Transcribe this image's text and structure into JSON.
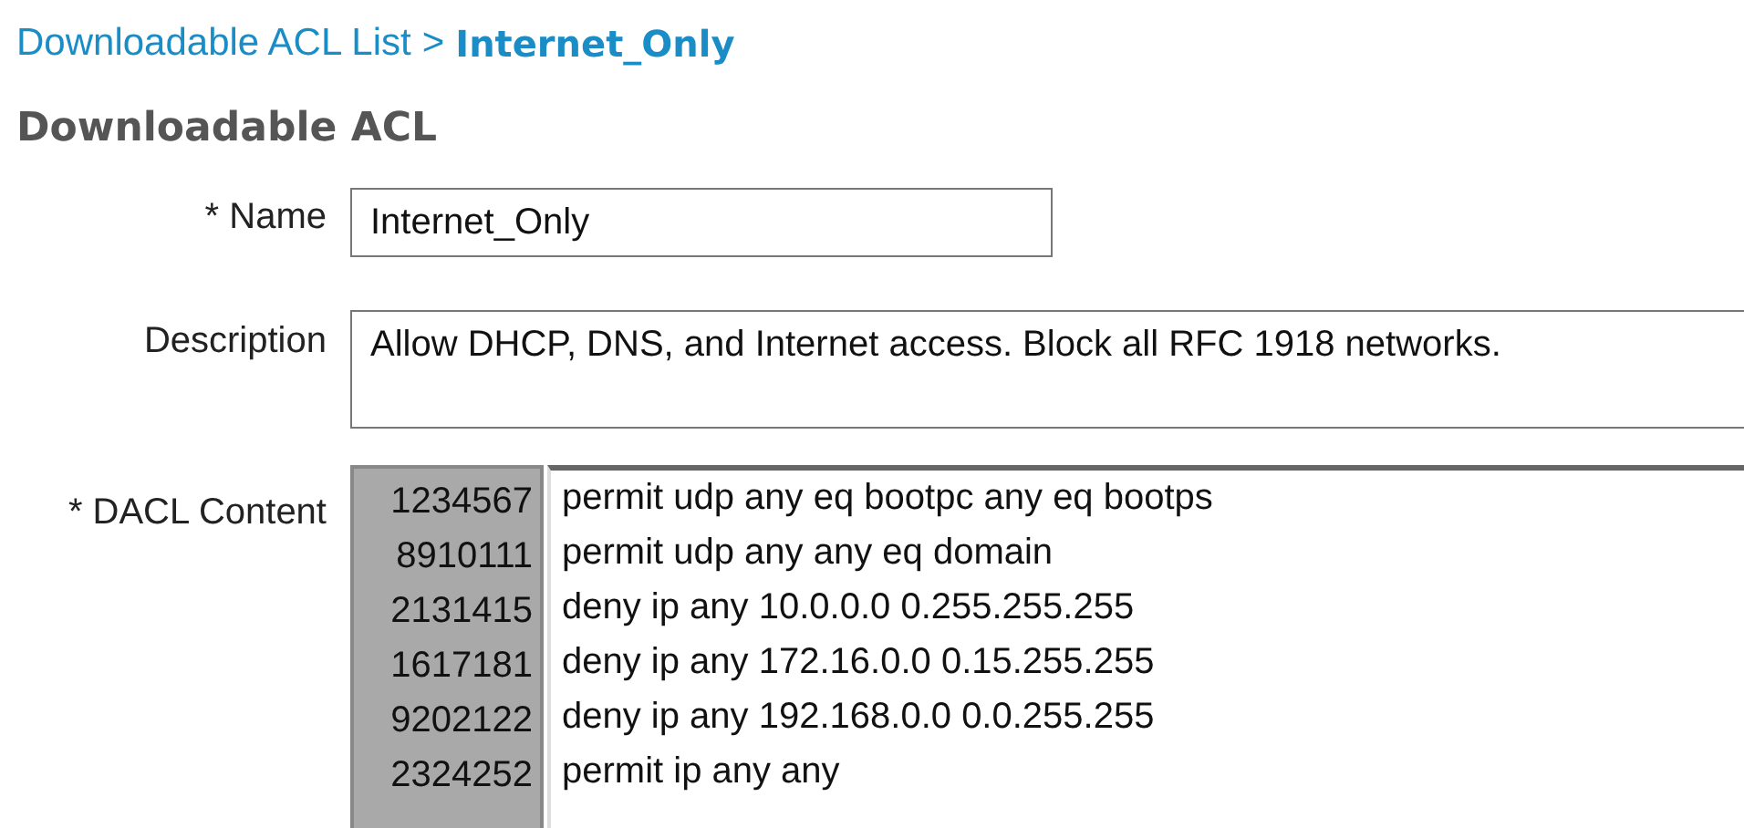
{
  "breadcrumb": {
    "parent": "Downloadable ACL List",
    "separator": ">",
    "current": "Internet_Only"
  },
  "heading": "Downloadable ACL",
  "form": {
    "name": {
      "label": "* Name",
      "value": "Internet_Only"
    },
    "description": {
      "label": "Description",
      "value": "Allow DHCP, DNS, and Internet access. Block all RFC 1918 networks."
    },
    "dacl": {
      "label": "* DACL Content",
      "lines": [
        {
          "number": "1234567",
          "text": "permit udp any eq bootpc any eq bootps"
        },
        {
          "number": "8910111",
          "text": "permit udp any any eq domain"
        },
        {
          "number": "2131415",
          "text": "deny ip any 10.0.0.0 0.255.255.255"
        },
        {
          "number": "1617181",
          "text": "deny ip any 172.16.0.0 0.15.255.255"
        },
        {
          "number": "9202122",
          "text": "deny ip any 192.168.0.0 0.0.255.255"
        },
        {
          "number": "2324252",
          "text": "permit ip any any"
        }
      ]
    }
  }
}
